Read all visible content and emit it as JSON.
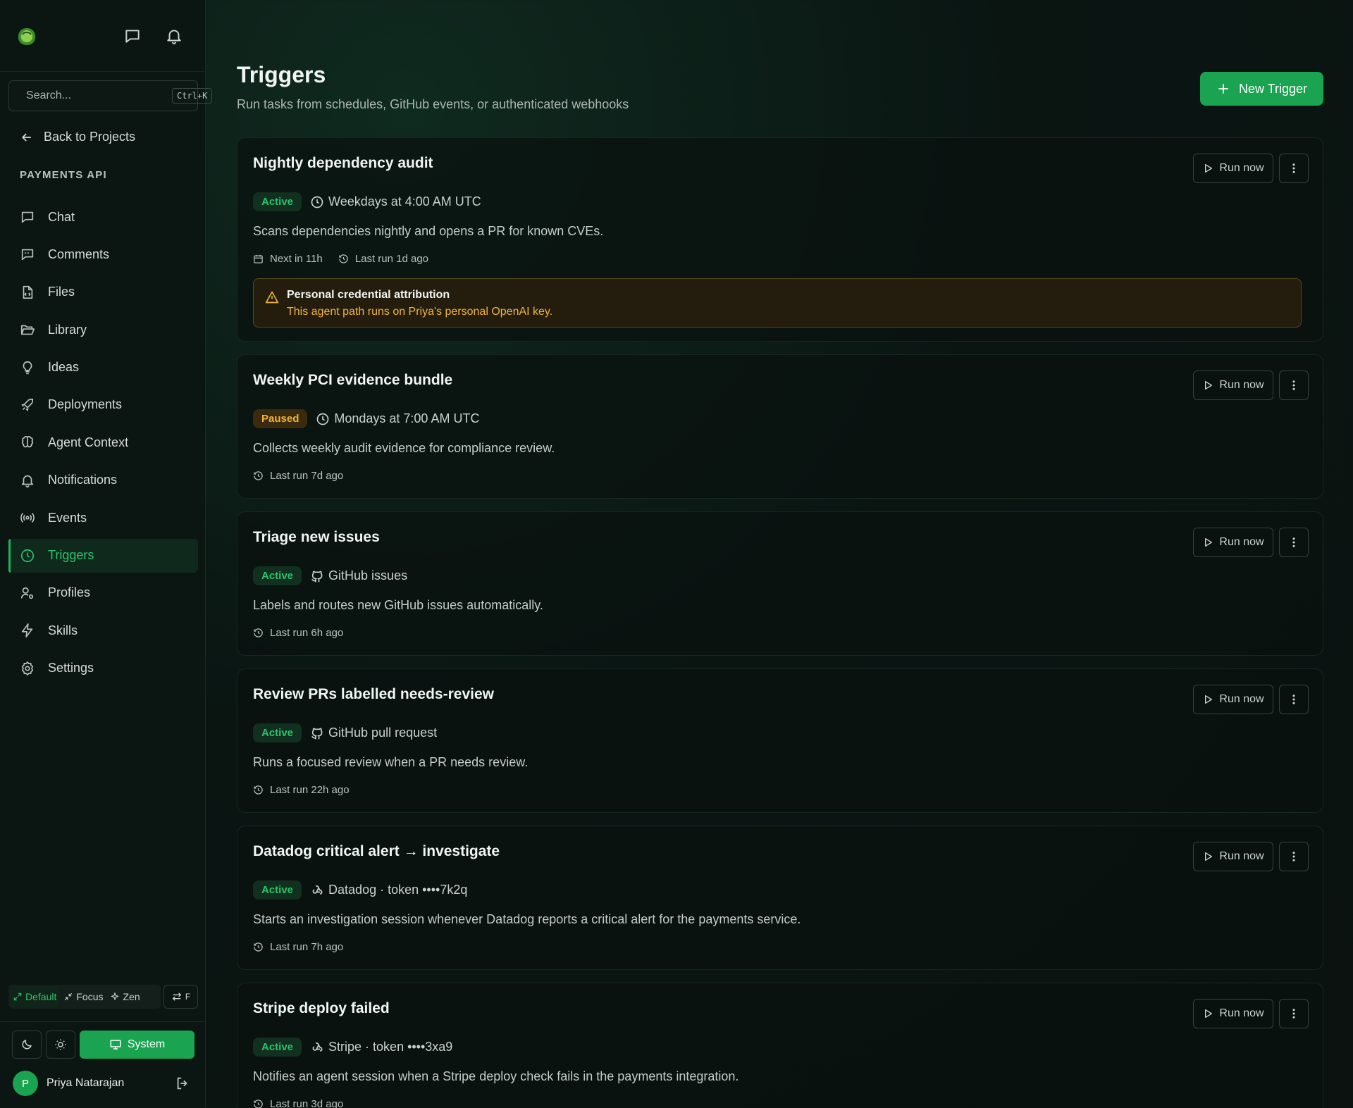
{
  "sidebar": {
    "search": {
      "placeholder": "Search...",
      "shortcut": "Ctrl+K"
    },
    "back_label": "Back to Projects",
    "project_label": "PAYMENTS API",
    "items": [
      {
        "label": "Chat",
        "icon": "chat-icon"
      },
      {
        "label": "Comments",
        "icon": "comments-icon"
      },
      {
        "label": "Files",
        "icon": "file-code-icon"
      },
      {
        "label": "Library",
        "icon": "folder-open-icon"
      },
      {
        "label": "Ideas",
        "icon": "lightbulb-icon"
      },
      {
        "label": "Deployments",
        "icon": "rocket-icon"
      },
      {
        "label": "Agent Context",
        "icon": "brain-icon"
      },
      {
        "label": "Notifications",
        "icon": "bell-icon"
      },
      {
        "label": "Events",
        "icon": "broadcast-icon"
      },
      {
        "label": "Triggers",
        "icon": "clock-icon",
        "active": true
      },
      {
        "label": "Profiles",
        "icon": "user-cog-icon"
      },
      {
        "label": "Skills",
        "icon": "zap-icon"
      },
      {
        "label": "Settings",
        "icon": "gear-icon"
      }
    ],
    "modes": [
      "Default",
      "Focus",
      "Zen"
    ],
    "swap_label": "F",
    "theme_system": "System",
    "user": {
      "initial": "P",
      "name": "Priya Natarajan"
    }
  },
  "main": {
    "title": "Triggers",
    "subtitle": "Run tasks from schedules, GitHub events, or authenticated webhooks",
    "new_button": "New Trigger",
    "run_label": "Run now",
    "cards": [
      {
        "title": "Nightly dependency audit",
        "status": "Active",
        "source": "Weekdays at 4:00 AM UTC",
        "description": "Scans dependencies nightly and opens a PR for known CVEs.",
        "next": "Next in 11h",
        "last": "Last run 1d ago",
        "warning": {
          "title": "Personal credential attribution",
          "text": "This agent path runs on Priya's personal OpenAI key."
        }
      },
      {
        "title": "Weekly PCI evidence bundle",
        "status": "Paused",
        "source": "Mondays at 7:00 AM UTC",
        "description": "Collects weekly audit evidence for compliance review.",
        "last": "Last run 7d ago"
      },
      {
        "title": "Triage new issues",
        "status": "Active",
        "source": "GitHub issues",
        "description": "Labels and routes new GitHub issues automatically.",
        "last": "Last run 6h ago"
      },
      {
        "title": "Review PRs labelled needs-review",
        "status": "Active",
        "source": "GitHub pull request",
        "description": "Runs a focused review when a PR needs review.",
        "last": "Last run 22h ago"
      },
      {
        "title": "Datadog critical alert → investigate",
        "status": "Active",
        "source": "Datadog · token ••••7k2q",
        "description": "Starts an investigation session whenever Datadog reports a critical alert for the payments service.",
        "last": "Last run 7h ago"
      },
      {
        "title": "Stripe deploy failed",
        "status": "Active",
        "source": "Stripe · token ••••3xa9",
        "description": "Notifies an agent session when a Stripe deploy check fails in the payments integration.",
        "last": "Last run 3d ago"
      }
    ]
  },
  "colors": {
    "accent": "#1aa350",
    "active_badge": "#2bc46a",
    "paused_badge": "#f0b43a",
    "warning": "#f0b43a"
  }
}
